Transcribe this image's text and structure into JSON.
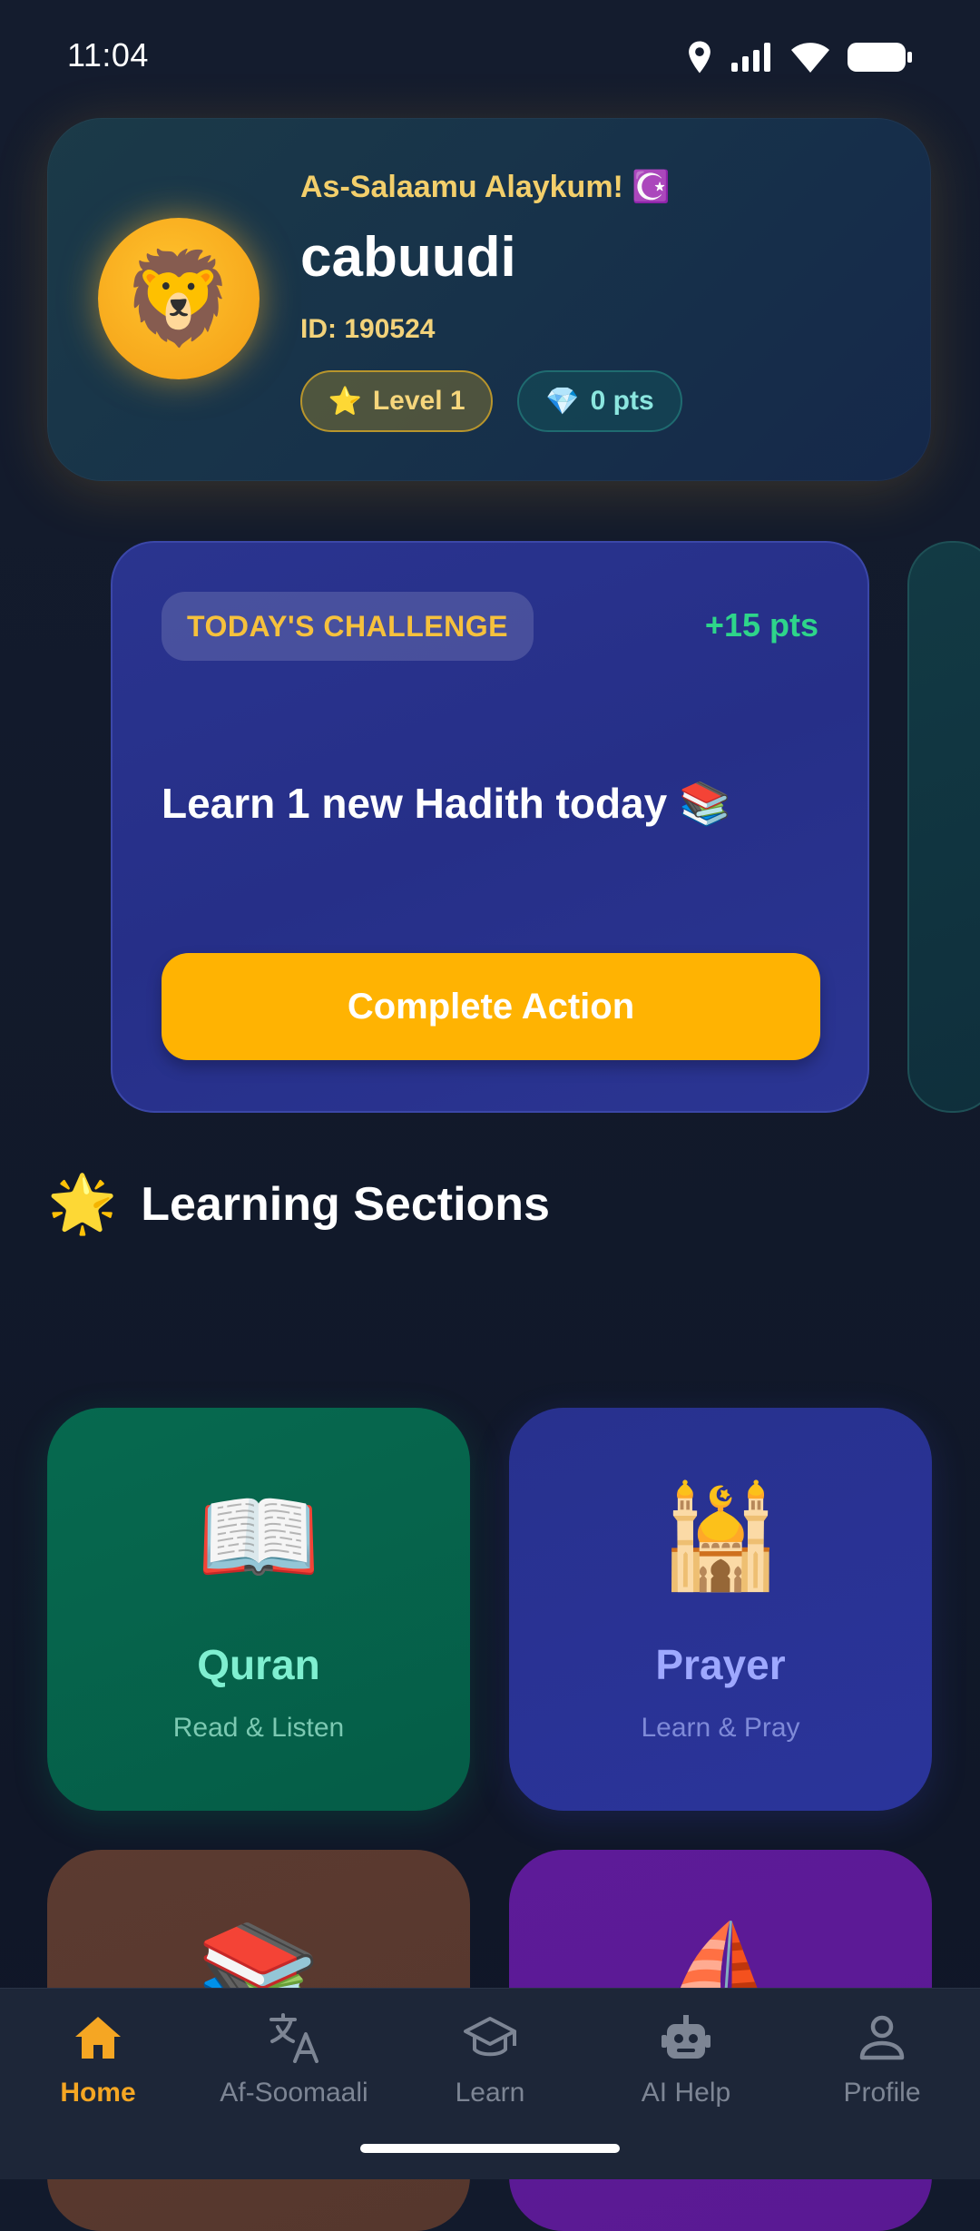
{
  "status_bar": {
    "time": "11:04",
    "icons": [
      "location-icon",
      "signal-icon",
      "wifi-icon",
      "battery-icon"
    ]
  },
  "profile": {
    "greeting": "As-Salaamu Alaykum! ☪️",
    "avatar_emoji": "🦁",
    "username": "cabuudi",
    "id_text": "ID: 190524",
    "level_icon": "⭐",
    "level_label": "Level 1",
    "points_icon": "💎",
    "points_label": "0 pts"
  },
  "challenge": {
    "badge": "TODAY'S CHALLENGE",
    "points": "+15 pts",
    "text": "Learn 1 new Hadith today 📚",
    "button_label": "Complete Action"
  },
  "sections": {
    "heading_icon": "🌟",
    "heading": "Learning Sections",
    "tiles": [
      {
        "icon": "📖",
        "title": "Quran",
        "subtitle": "Read & Listen"
      },
      {
        "icon": "🕌",
        "title": "Prayer",
        "subtitle": "Learn & Pray"
      },
      {
        "icon": "📚"
      },
      {
        "icon": "⛵"
      }
    ]
  },
  "nav": {
    "items": [
      {
        "label": "Home",
        "icon": "home-icon",
        "active": true
      },
      {
        "label": "Af-Soomaali",
        "icon": "translate-icon",
        "active": false
      },
      {
        "label": "Learn",
        "icon": "graduation-cap-icon",
        "active": false
      },
      {
        "label": "AI Help",
        "icon": "robot-icon",
        "active": false
      },
      {
        "label": "Profile",
        "icon": "person-icon",
        "active": false
      }
    ]
  },
  "colors": {
    "accent": "#ffb302",
    "active_nav": "#f5a623",
    "points_green": "#2ed58a",
    "background": "#121a2c"
  }
}
